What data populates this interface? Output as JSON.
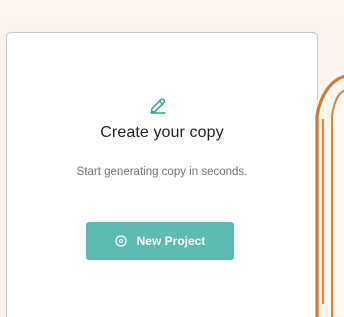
{
  "card": {
    "icon": "pencil-icon",
    "title": "Create your copy",
    "description": "Start generating copy in seconds.",
    "button": {
      "label": "New Project",
      "icon": "plus-circle-icon"
    }
  },
  "colors": {
    "background": "#fbf4ec",
    "accent": "#5dbaaf",
    "illustration_stroke": "#d07a33"
  }
}
